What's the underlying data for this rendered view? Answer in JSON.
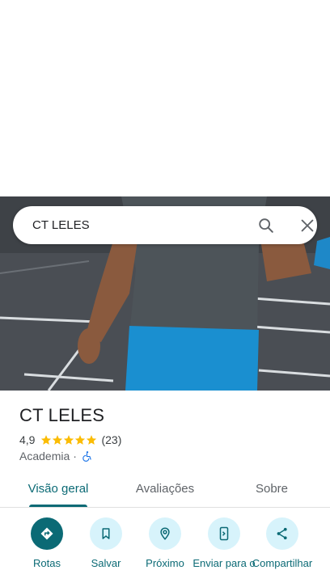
{
  "search": {
    "query": "CT LELES"
  },
  "place": {
    "name": "CT LELES",
    "rating": "4,9",
    "stars": 5,
    "review_count": "(23)",
    "category": "Academia",
    "separator": "·"
  },
  "tabs": [
    {
      "label": "Visão geral",
      "active": true
    },
    {
      "label": "Avaliações",
      "active": false
    },
    {
      "label": "Sobre",
      "active": false
    }
  ],
  "actions": [
    {
      "label": "Rotas",
      "icon": "directions-icon"
    },
    {
      "label": "Salvar",
      "icon": "bookmark-icon"
    },
    {
      "label": "Próximo",
      "icon": "nearby-icon"
    },
    {
      "label": "Enviar para o",
      "icon": "send-to-phone-icon"
    },
    {
      "label": "Compartilhar",
      "icon": "share-icon"
    }
  ],
  "colors": {
    "accent": "#0b6a75",
    "action_bg": "#d7f3fb",
    "star": "#fbbc04",
    "wheelchair": "#1a73e8"
  }
}
